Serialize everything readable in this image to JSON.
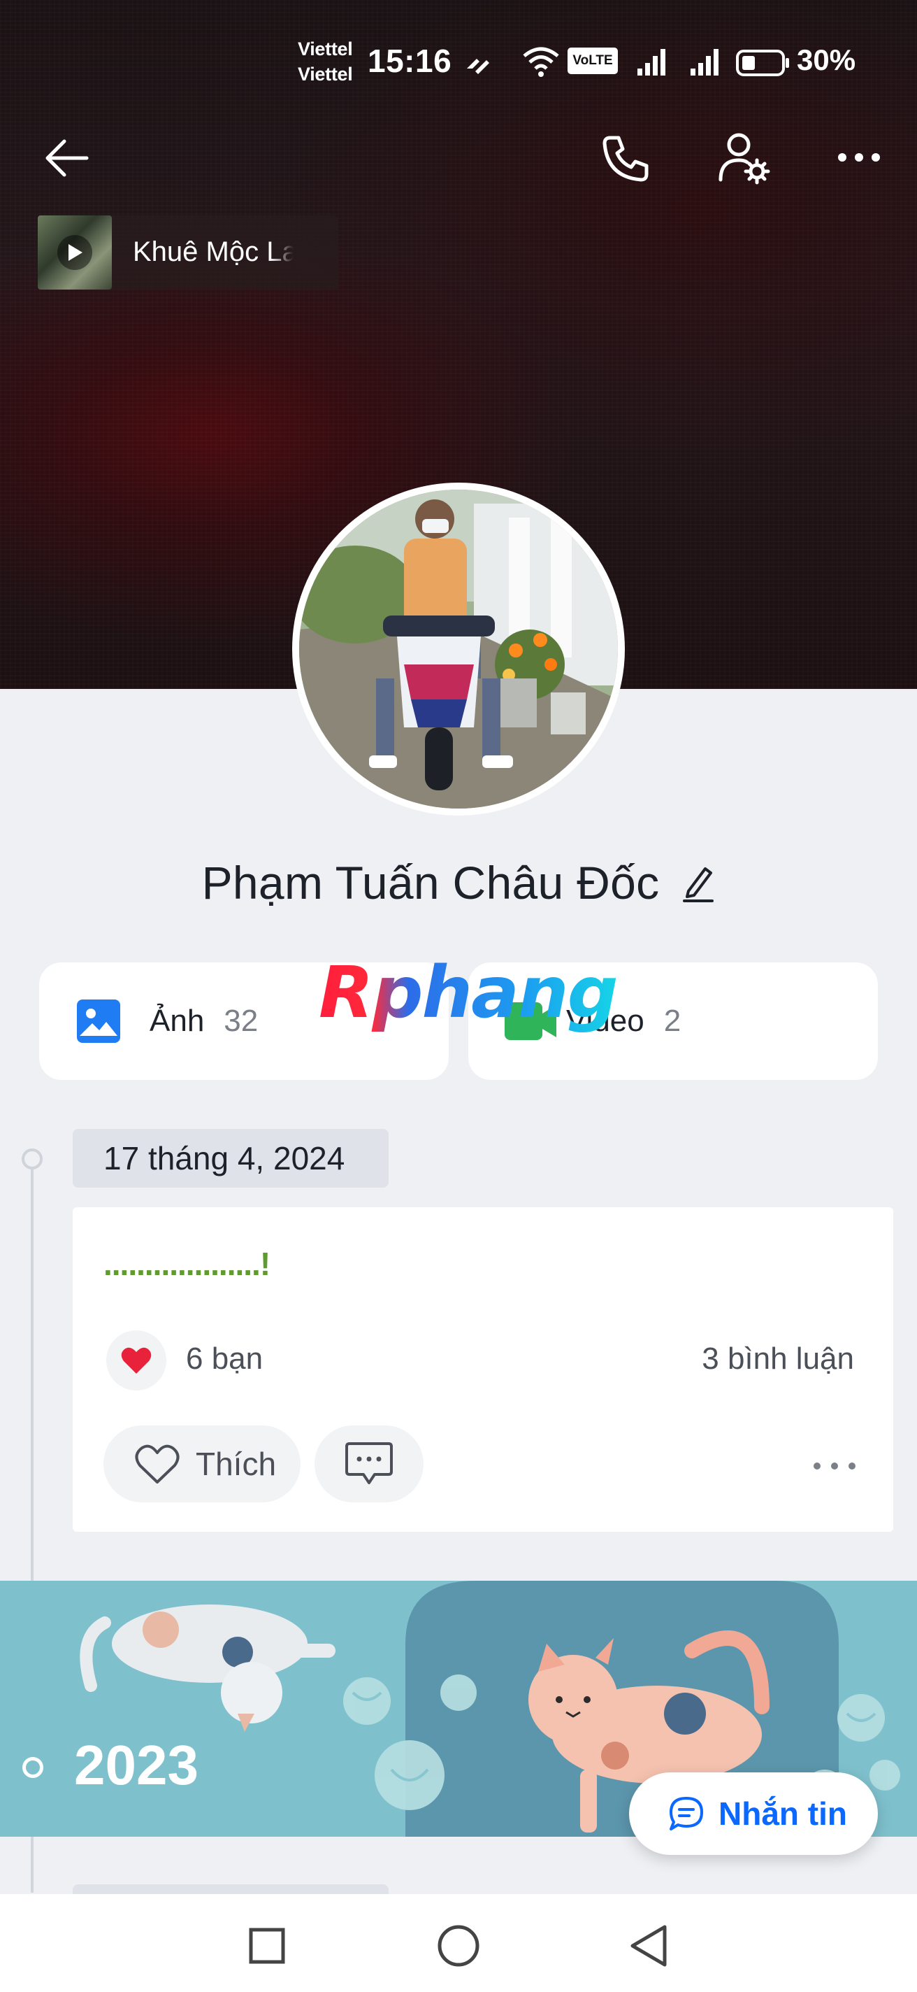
{
  "status_bar": {
    "carrier_1": "Viettel",
    "carrier_2": "Viettel",
    "time": "15:16",
    "volte": "VoLTE",
    "battery": "30%"
  },
  "header": {
    "back_icon": "back-arrow-icon",
    "call_icon": "phone-icon",
    "settings_icon": "user-settings-icon",
    "more_icon": "more-dots-icon"
  },
  "music": {
    "title": "Khuê Mộc Lang"
  },
  "profile": {
    "name": "Phạm Tuấn Châu Đốc",
    "edit_icon": "pencil-icon"
  },
  "media": {
    "photos_label": "Ảnh",
    "photos_count": "32",
    "videos_label": "Video",
    "videos_count": "2"
  },
  "watermark": "Rphang",
  "timeline": {
    "date": "17 tháng 4, 2024",
    "post": {
      "text": "...................!",
      "reactions": "6 bạn",
      "comments": "3 bình luận",
      "like_label": "Thích"
    },
    "year": "2023"
  },
  "fab": {
    "label": "Nhắn tin"
  },
  "colors": {
    "accent": "#0a68ff",
    "post_text": "#5f9b2e",
    "banner": "#7cc0cc"
  }
}
